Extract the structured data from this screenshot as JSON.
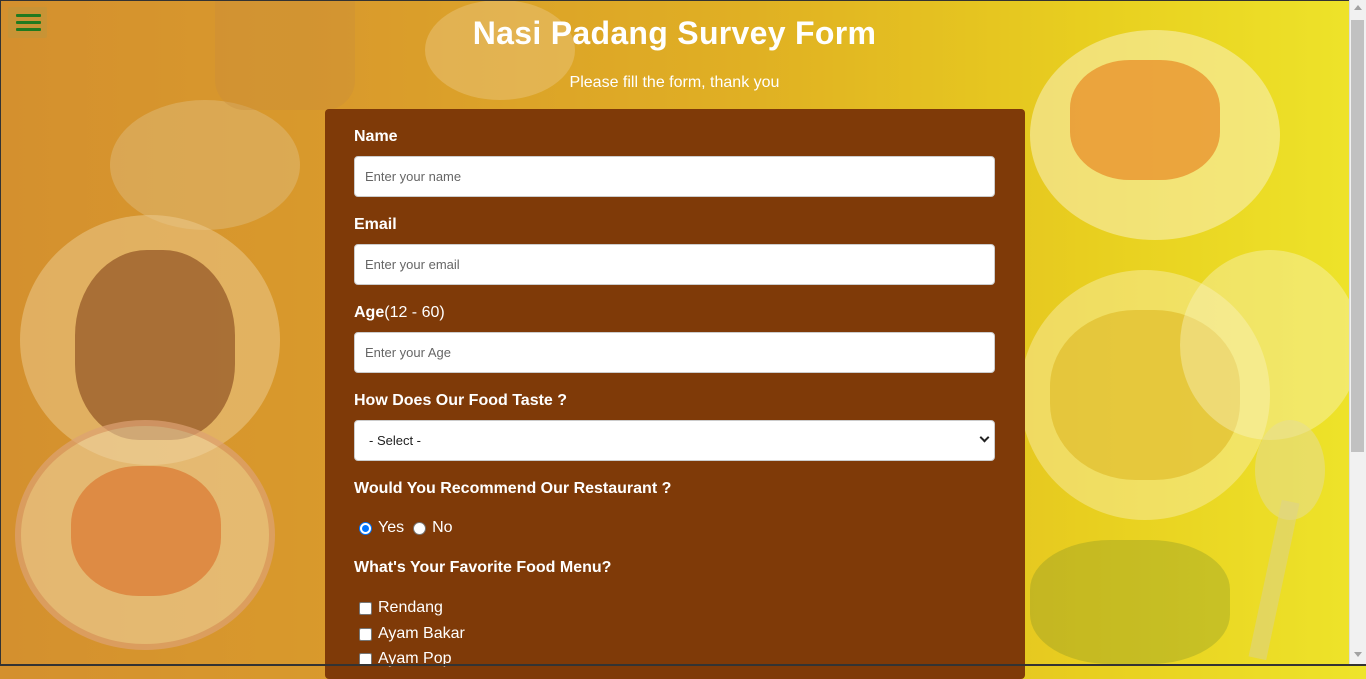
{
  "page": {
    "title": "Nasi Padang Survey Form",
    "subtitle": "Please fill the form, thank you"
  },
  "menu": {
    "icon": "hamburger-menu-icon"
  },
  "form": {
    "name": {
      "label": "Name",
      "placeholder": "Enter your name"
    },
    "email": {
      "label": "Email",
      "placeholder": "Enter your email"
    },
    "age": {
      "label": "Age",
      "label_extra": "(12 - 60)",
      "placeholder": "Enter your Age"
    },
    "taste": {
      "label": "How Does Our Food Taste ?",
      "selected": "- Select -"
    },
    "recommend": {
      "label": "Would You Recommend Our Restaurant ?",
      "options": [
        {
          "label": "Yes",
          "checked": true
        },
        {
          "label": "No",
          "checked": false
        }
      ]
    },
    "favorite": {
      "label": "What's Your Favorite Food Menu?",
      "options": [
        {
          "label": "Rendang",
          "checked": false
        },
        {
          "label": "Ayam Bakar",
          "checked": false
        },
        {
          "label": "Ayam Pop",
          "checked": false
        }
      ]
    }
  },
  "colors": {
    "form_background": "#7f3a08",
    "accent_radio": "#0075ff",
    "menu_icon": "#1f7a1f"
  }
}
